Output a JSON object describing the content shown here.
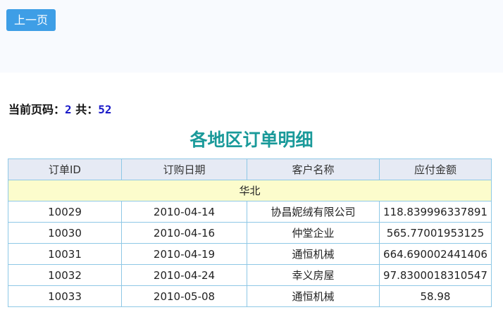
{
  "toolbar": {
    "prev_label": "上一页"
  },
  "pager": {
    "current_label": "当前页码：",
    "current": "2",
    "total_label": "共：",
    "total": "52"
  },
  "report": {
    "title": "各地区订单明细",
    "columns": [
      "订单ID",
      "订购日期",
      "客户名称",
      "应付金额"
    ],
    "group": "华北",
    "rows": [
      [
        "10029",
        "2010-04-14",
        "协昌妮绒有限公司",
        "118.839996337891"
      ],
      [
        "10030",
        "2010-04-16",
        "仲堂企业",
        "565.77001953125"
      ],
      [
        "10031",
        "2010-04-19",
        "通恒机械",
        "664.690002441406"
      ],
      [
        "10032",
        "2010-04-24",
        "幸义房屋",
        "97.8300018310547"
      ],
      [
        "10033",
        "2010-05-08",
        "通恒机械",
        "58.98"
      ]
    ]
  },
  "colors": {
    "button": "#3e9ee6",
    "title": "#1a9a9a",
    "header_bg": "#e6eaf4",
    "group_bg": "#fcfccc",
    "border": "#8ec8e6",
    "page_number": "#1a1ac8"
  }
}
